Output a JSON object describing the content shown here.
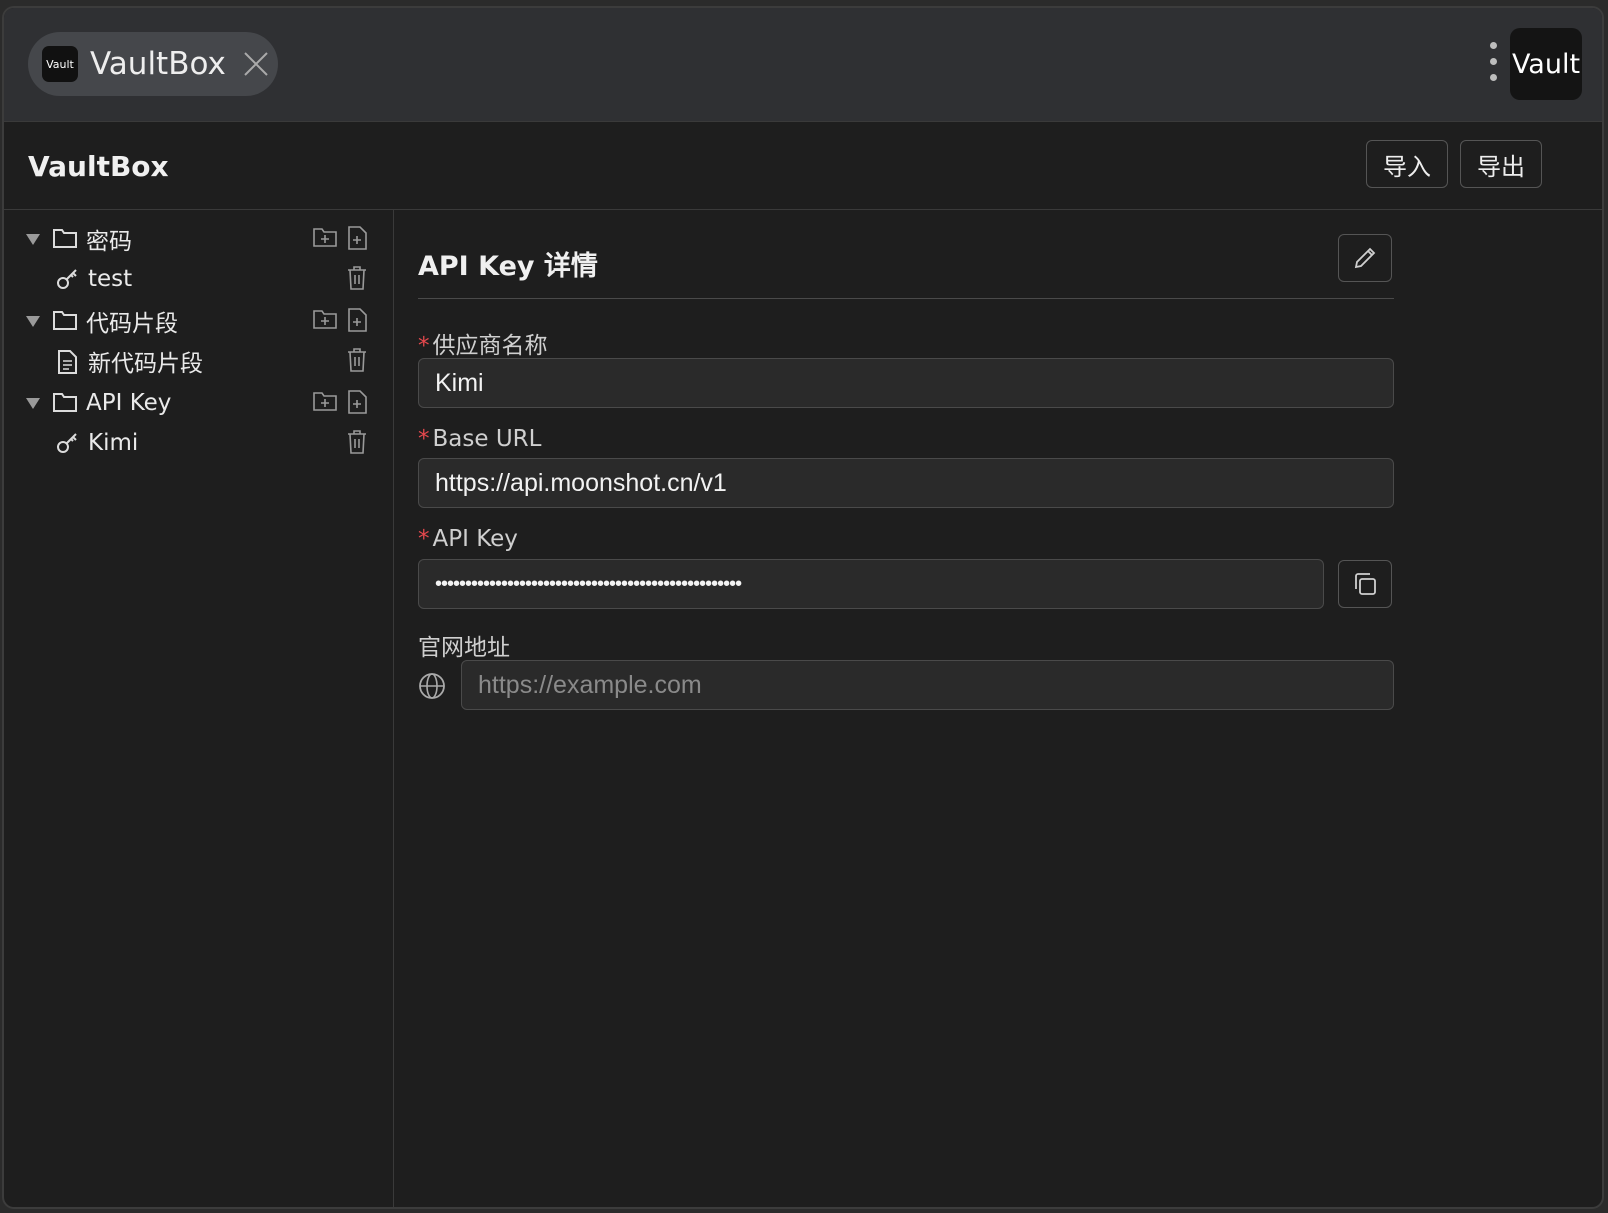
{
  "titlebar": {
    "tab_logo_text": "Vault",
    "tab_title": "VaultBox",
    "corner_button_label": "Vault"
  },
  "header": {
    "app_title": "VaultBox",
    "import_label": "导入",
    "export_label": "导出"
  },
  "sidebar": {
    "groups": [
      {
        "label": "密码",
        "items": [
          {
            "label": "test",
            "icon": "key-icon"
          }
        ]
      },
      {
        "label": "代码片段",
        "items": [
          {
            "label": "新代码片段",
            "icon": "document-icon"
          }
        ]
      },
      {
        "label": "API Key",
        "items": [
          {
            "label": "Kimi",
            "icon": "key-icon"
          }
        ]
      }
    ]
  },
  "detail": {
    "title": "API Key 详情",
    "fields": {
      "provider": {
        "label": "供应商名称",
        "value": "Kimi"
      },
      "base_url": {
        "label": "Base URL",
        "value": "https://api.moonshot.cn/v1"
      },
      "api_key": {
        "label": "API Key",
        "value": "•••••••••••••••••••••••••••••••••••••••••••••••••••"
      },
      "website": {
        "label": "官网地址",
        "placeholder": "https://example.com"
      }
    },
    "required_mark": "*"
  }
}
